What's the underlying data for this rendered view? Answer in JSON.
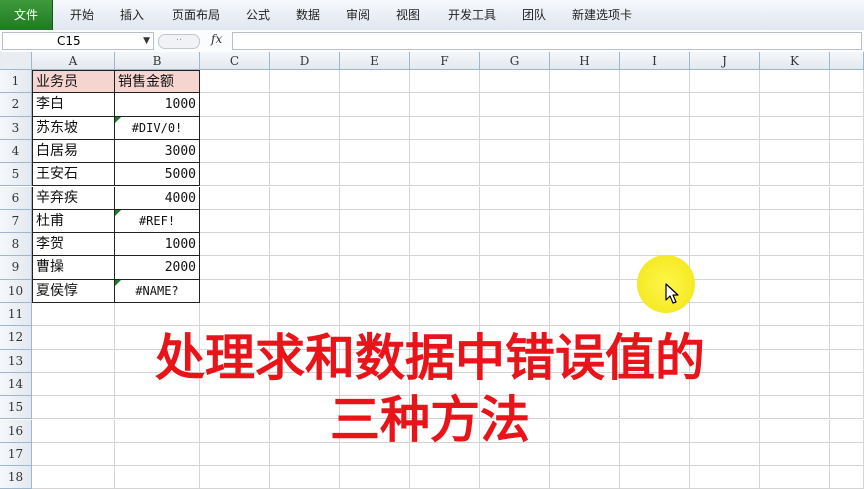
{
  "ribbon": {
    "tabs": [
      "文件",
      "开始",
      "插入",
      "页面布局",
      "公式",
      "数据",
      "审阅",
      "视图",
      "开发工具",
      "团队",
      "新建选项卡"
    ]
  },
  "formula_bar": {
    "name_box": "C15",
    "fx_label": "fx",
    "formula": ""
  },
  "sheet": {
    "columns": [
      "A",
      "B",
      "C",
      "D",
      "E",
      "F",
      "G",
      "H",
      "I",
      "J",
      "K"
    ],
    "rows": [
      "1",
      "2",
      "3",
      "4",
      "5",
      "6",
      "7",
      "8",
      "9",
      "10",
      "11",
      "12",
      "13",
      "14",
      "15",
      "16",
      "17",
      "18"
    ],
    "table": [
      {
        "a": "业务员",
        "b": "销售金额"
      },
      {
        "a": "李白",
        "b": "1000"
      },
      {
        "a": "苏东坡",
        "b": "#DIV/0!"
      },
      {
        "a": "白居易",
        "b": "3000"
      },
      {
        "a": "王安石",
        "b": "5000"
      },
      {
        "a": "辛弃疾",
        "b": "4000"
      },
      {
        "a": "杜甫",
        "b": "#REF!"
      },
      {
        "a": "李贺",
        "b": "1000"
      },
      {
        "a": "曹操",
        "b": "2000"
      },
      {
        "a": "夏侯惇",
        "b": "#NAME?"
      }
    ],
    "header_fill": "#f6d5d0",
    "error_indicator_color": "#1c7a2a"
  },
  "overlay": {
    "line1": "处理求和数据中错误值的",
    "line2": "三种方法",
    "color": "#e8141a"
  },
  "cursor": {
    "highlight_color": "#f5ea25",
    "icon": "mouse-pointer-icon"
  }
}
